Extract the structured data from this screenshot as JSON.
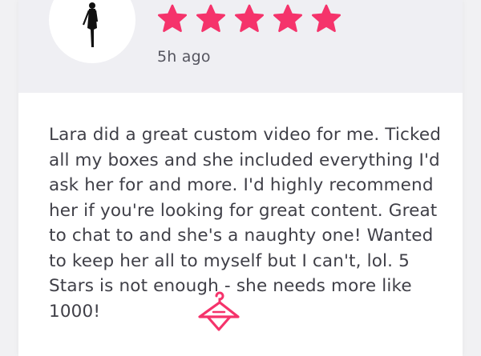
{
  "review": {
    "rating": 5,
    "rating_max": 5,
    "star_color": "#f5336b",
    "time_ago": "5h ago",
    "text": "Lara did a great custom video for me. Ticked all my boxes and she included everything I'd ask her for and more. I'd highly recommend her if you're looking for great content. Great to chat to and she's a naughty one! Wanted to keep her all to myself but I can't, lol. 5 Stars is not enough - she needs more like 1000!"
  },
  "avatar": {
    "icon": "female-figure-icon"
  },
  "watermark": {
    "icon": "hanger-logo-icon",
    "color": "#f5336b"
  }
}
